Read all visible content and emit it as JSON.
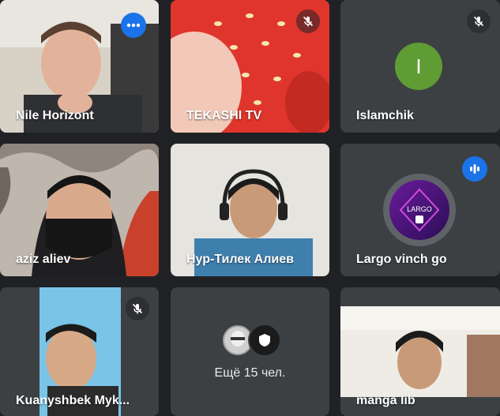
{
  "participants": [
    {
      "name": "Nile Horizont",
      "state": "speaking-selected",
      "menu_icon": "more-options-icon"
    },
    {
      "name": "TEKASHI TV",
      "state": "muted"
    },
    {
      "name": "Islamchik",
      "state": "muted",
      "avatar_letter": "I",
      "avatar_color": "#5f9c34"
    },
    {
      "name": "aziz aliev"
    },
    {
      "name": "Нур-Тилек Алиев"
    },
    {
      "name": "Largo vinch go",
      "state": "speaking",
      "avatar_text": "LARGO"
    },
    {
      "name": "Kuanyshbek Myk...",
      "state": "muted"
    },
    {
      "name": "manga lib"
    }
  ],
  "overflow": {
    "label": "Ещё 15 чел."
  },
  "colors": {
    "background": "#202124",
    "tile": "#3c4043",
    "accent": "#1a73e8",
    "active_border": "#8ab4f8"
  }
}
